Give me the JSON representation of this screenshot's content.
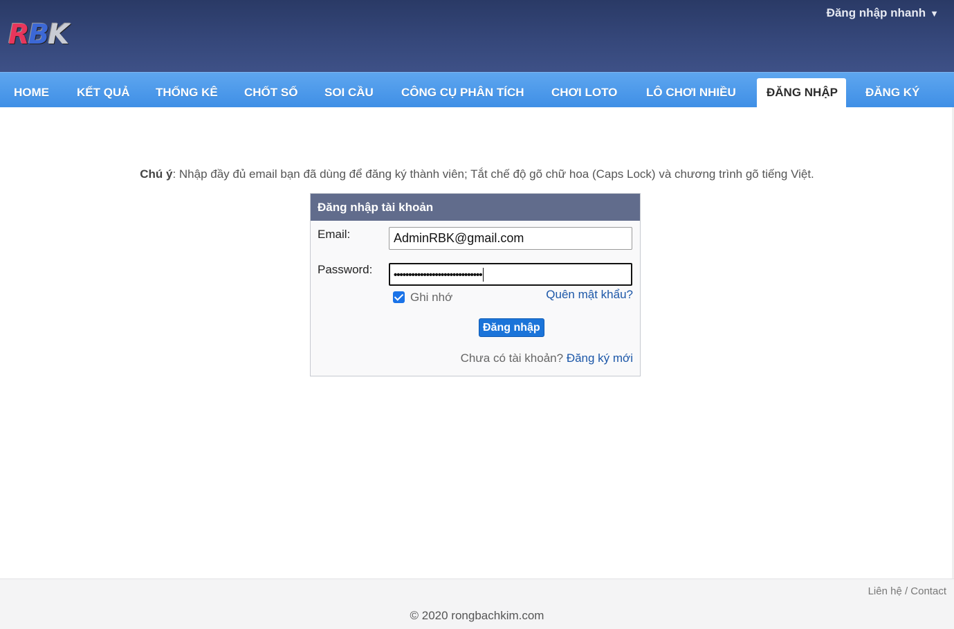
{
  "header": {
    "logo": {
      "r": "R",
      "b": "B",
      "k": "K"
    },
    "quick_login": "Đăng nhập nhanh",
    "quick_login_caret": "▼"
  },
  "nav": {
    "items": [
      {
        "label": "HOME"
      },
      {
        "label": "KẾT QUẢ"
      },
      {
        "label": "THỐNG KÊ"
      },
      {
        "label": "CHỐT SỐ"
      },
      {
        "label": "SOI CẦU"
      },
      {
        "label": "CÔNG CỤ PHÂN TÍCH"
      },
      {
        "label": "CHƠI LOTO"
      },
      {
        "label": "LÔ CHƠI NHIỀU"
      },
      {
        "label": "ĐĂNG NHẬP",
        "active": true
      },
      {
        "label": "ĐĂNG KÝ"
      }
    ]
  },
  "notice": {
    "prefix": "Chú ý",
    "text": ": Nhập đầy đủ email bạn đã dùng để đăng ký thành viên; Tắt chế độ gõ chữ hoa (Caps Lock) và chương trình gõ tiếng Việt."
  },
  "login": {
    "title": "Đăng nhập tài khoản",
    "email_label": "Email:",
    "email_value": "AdminRBK@gmail.com",
    "password_label": "Password:",
    "password_value": "••••••••••••••••••••••••••••••",
    "remember_label": "Ghi nhớ",
    "forgot_label": "Quên mật khẩu?",
    "submit_label": "Đăng nhập",
    "no_account_text": "Chưa có tài khoản? ",
    "register_label": "Đăng ký mới"
  },
  "footer": {
    "contact": "Liên hệ / Contact",
    "copyright": "© 2020 rongbachkim.com"
  },
  "colors": {
    "header_bg": "#35477a",
    "nav_bg": "#4a97ea",
    "box_title_bg": "#616c8c",
    "button_bg": "#1b74d9",
    "link": "#1c57a8"
  }
}
